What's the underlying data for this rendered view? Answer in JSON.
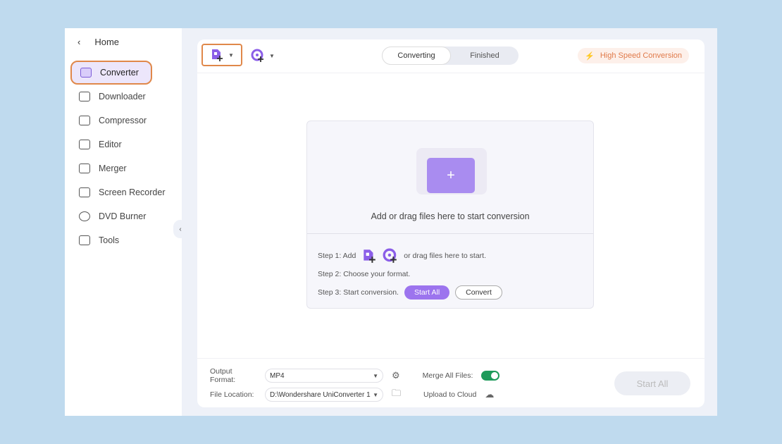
{
  "sidebar": {
    "home": "Home",
    "items": [
      {
        "label": "Converter",
        "icon": "converter-icon"
      },
      {
        "label": "Downloader",
        "icon": "download-icon"
      },
      {
        "label": "Compressor",
        "icon": "compress-icon"
      },
      {
        "label": "Editor",
        "icon": "scissors-icon"
      },
      {
        "label": "Merger",
        "icon": "merge-icon"
      },
      {
        "label": "Screen Recorder",
        "icon": "record-icon"
      },
      {
        "label": "DVD Burner",
        "icon": "dvd-icon"
      },
      {
        "label": "Tools",
        "icon": "grid-icon"
      }
    ]
  },
  "tabs": {
    "converting": "Converting",
    "finished": "Finished"
  },
  "hsc": "High Speed Conversion",
  "drop": {
    "text": "Add or drag files here to start conversion",
    "plus": "+",
    "step1": "Step 1: Add",
    "step1b": "or drag files here to start.",
    "step2": "Step 2: Choose your format.",
    "step3": "Step 3: Start conversion.",
    "start_all": "Start All",
    "convert": "Convert"
  },
  "bottom": {
    "output_label": "Output Format:",
    "output_value": "MP4",
    "location_label": "File Location:",
    "location_value": "D:\\Wondershare UniConverter 1",
    "merge_label": "Merge All Files:",
    "merge_on": true,
    "cloud_label": "Upload to Cloud",
    "start_all": "Start All"
  },
  "colors": {
    "accent": "#9c74ee",
    "highlight": "#e0884a",
    "toggle": "#1e9a5a"
  }
}
